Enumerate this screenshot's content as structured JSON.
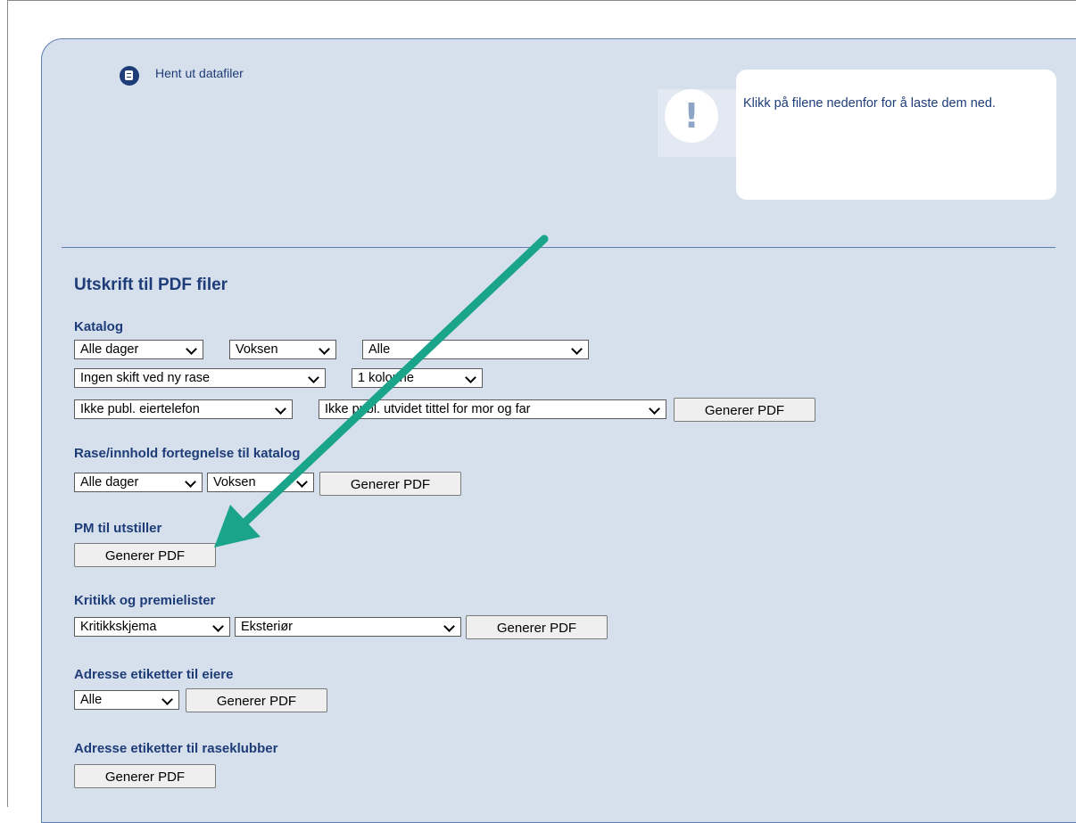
{
  "header": {
    "title": "Hent ut datafiler",
    "icon": "document-icon"
  },
  "info": {
    "icon": "exclamation-icon",
    "message": "Klikk på filene nedenfor for å laste dem ned."
  },
  "section_title": "Utskrift til PDF filer",
  "generate_label": "Generer PDF",
  "katalog": {
    "label": "Katalog",
    "days": "Alle dager",
    "class": "Voksen",
    "breed": "Alle",
    "shift": "Ingen skift ved ny rase",
    "columns": "1 kolonne",
    "phone": "Ikke publ. eiertelefon",
    "title_option": "Ikke publ. utvidet tittel for mor og far"
  },
  "rase": {
    "label": "Rase/innhold fortegnelse til katalog",
    "days": "Alle dager",
    "class": "Voksen"
  },
  "pm": {
    "label": "PM til utstiller"
  },
  "kritikk": {
    "label": "Kritikk og premielister",
    "type": "Kritikkskjema",
    "form": "Eksteriør"
  },
  "adresse_eiere": {
    "label": "Adresse etiketter til eiere",
    "filter": "Alle"
  },
  "adresse_klubber": {
    "label": "Adresse etiketter til raseklubber"
  },
  "colors": {
    "panel": "#d6e0ec",
    "text": "#1e3c78",
    "arrow": "#1aa48a"
  }
}
